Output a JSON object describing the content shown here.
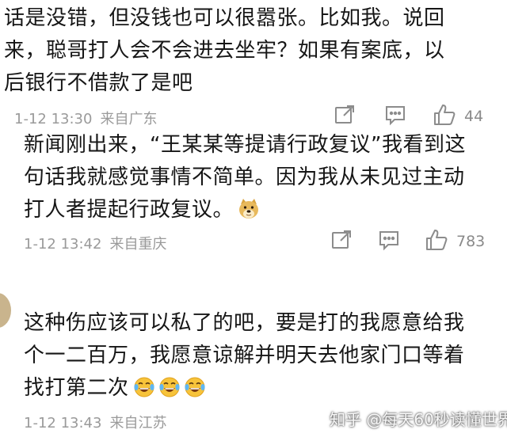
{
  "comments": [
    {
      "lines": [
        "话是没错，但没钱也可以很嚣张。比如我。说回",
        "来，聪哥打人会不会进去坐牢？如果有案底，以",
        "后银行不借款了是吧"
      ],
      "time": "1-12 13:30",
      "source": "来自广东",
      "likes": "44"
    },
    {
      "lines": [
        "新闻刚出来，“王某某等提请行政复议”我看到这",
        "句话我就感觉事情不简单。因为我从未见过主动",
        "打人者提起行政复议。"
      ],
      "emoji": "doge-emoji",
      "time": "1-12 13:42",
      "source": "来自重庆",
      "likes": "783"
    },
    {
      "lines": [
        "这种伤应该可以私了的吧，要是打的我愿意给我",
        "个一二百万，我愿意谅解并明天去他家门口等着",
        "找打第二次"
      ],
      "emoji": "tears-of-joy-emoji",
      "time": "1-12 13:43",
      "source": "来自江苏"
    }
  ],
  "icons": [
    "share-icon",
    "comment-icon",
    "like-icon"
  ],
  "watermark": "知乎 @每天60秒读懂世界",
  "colors": {
    "text": "#161616",
    "meta": "#9a9a9a",
    "icon": "#8c8c8c",
    "background": "#ffffff"
  }
}
